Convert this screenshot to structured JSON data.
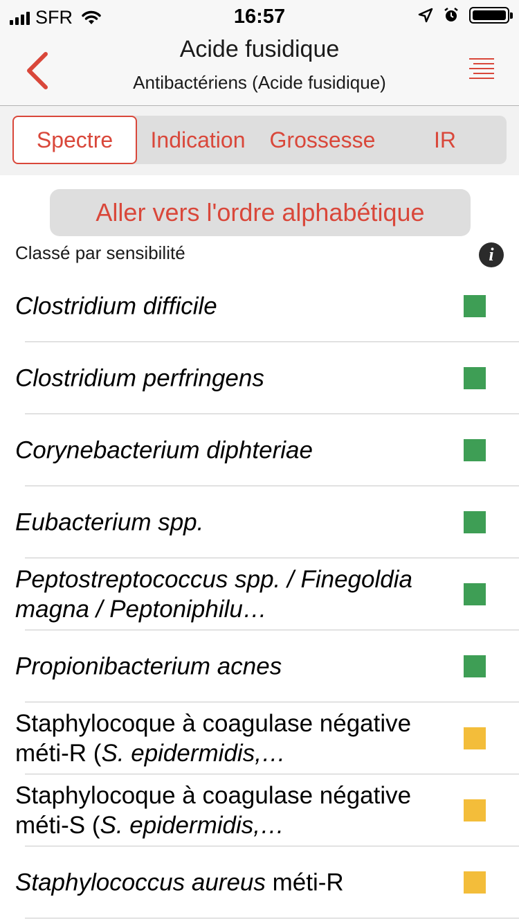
{
  "status_bar": {
    "carrier": "SFR",
    "time": "16:57"
  },
  "nav": {
    "title": "Acide fusidique",
    "subtitle": "Antibactériens (Acide fusidique)"
  },
  "tabs": [
    {
      "label": "Spectre",
      "active": true
    },
    {
      "label": "Indication",
      "active": false
    },
    {
      "label": "Grossesse",
      "active": false
    },
    {
      "label": "IR",
      "active": false
    }
  ],
  "alpha_button": {
    "label": "Aller vers l'ordre alphabétique"
  },
  "sort_label": "Classé par sensibilité",
  "info_icon_text": "i",
  "colors": {
    "accent": "#d9473a",
    "sensitive": "#3e9e55",
    "intermediate": "#f3bd3a"
  },
  "organisms": [
    {
      "label": "Clostridium difficile",
      "italic": "Clostridium difficile",
      "rest": "",
      "status": "sensitive",
      "color": "#3e9e55"
    },
    {
      "label": "Clostridium perfringens",
      "italic": "Clostridium perfringens",
      "rest": "",
      "status": "sensitive",
      "color": "#3e9e55"
    },
    {
      "label": "Corynebacterium diphteriae",
      "italic": "Corynebacterium diphteriae",
      "rest": "",
      "status": "sensitive",
      "color": "#3e9e55"
    },
    {
      "label": "Eubacterium spp.",
      "italic": "Eubacterium spp.",
      "rest": "",
      "status": "sensitive",
      "color": "#3e9e55"
    },
    {
      "label": "Peptostreptococcus spp. / Finegoldia magna / Peptoniphilu…",
      "italic": "Peptostreptococcus spp. / Finegoldia magna / Peptoniphilu…",
      "rest": "",
      "status": "sensitive",
      "color": "#3e9e55"
    },
    {
      "label": "Propionibacterium acnes",
      "italic": "Propionibacterium acnes",
      "rest": "",
      "status": "sensitive",
      "color": "#3e9e55"
    },
    {
      "label": "Staphylocoque à coagulase négative méti-R (S. epidermidis,…",
      "plain": "Staphylocoque à coagulase négative méti-R (",
      "italic": "S. epidermidis,…",
      "status": "intermediate",
      "color": "#f3bd3a"
    },
    {
      "label": "Staphylocoque à coagulase négative méti-S (S. epidermidis,…",
      "plain": "Staphylocoque à coagulase négative méti-S (",
      "italic": "S. epidermidis,…",
      "status": "intermediate",
      "color": "#f3bd3a"
    },
    {
      "label": "Staphylococcus aureus méti-R",
      "italic": "Staphylococcus aureus",
      "rest": " méti-R",
      "status": "intermediate",
      "color": "#f3bd3a"
    }
  ]
}
